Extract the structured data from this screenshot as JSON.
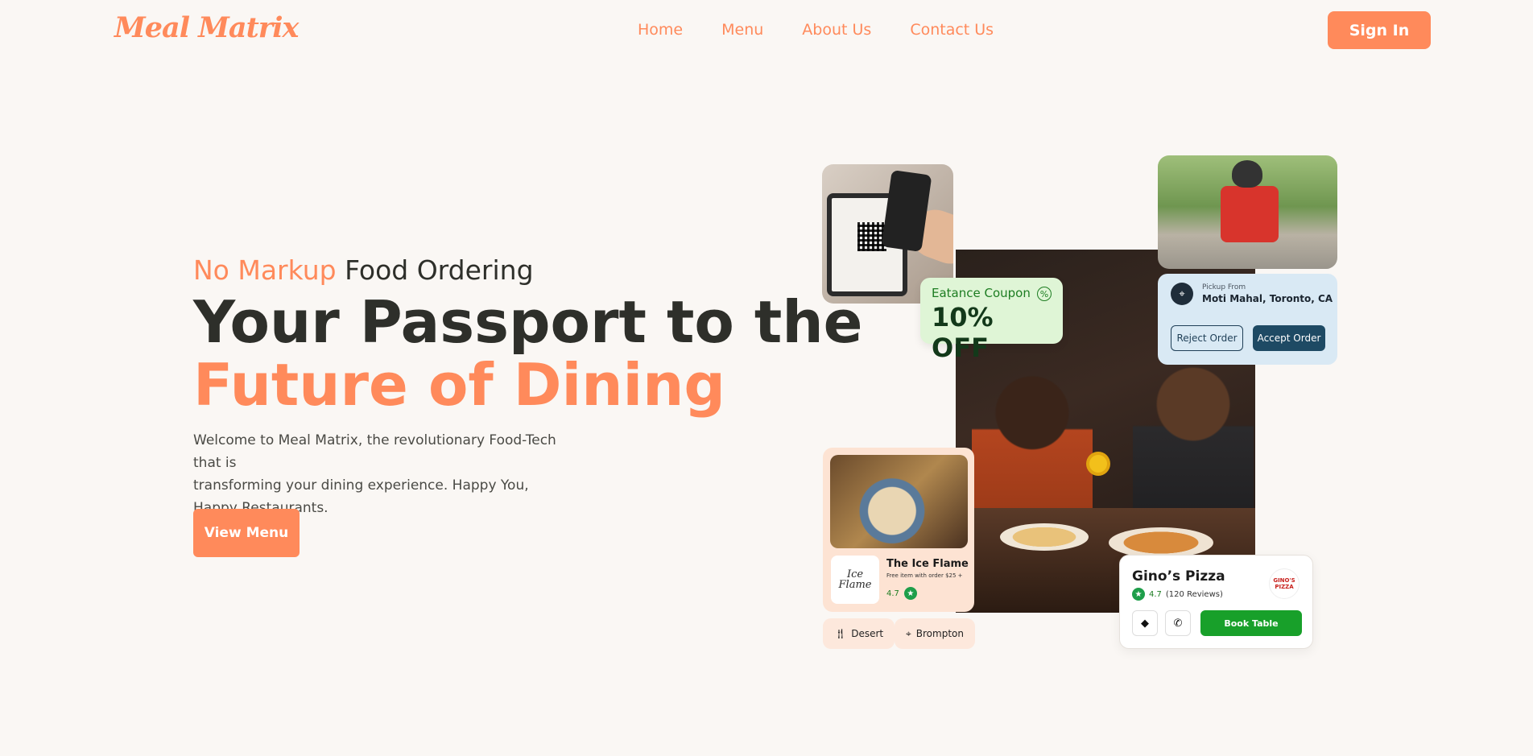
{
  "brand": {
    "logo_text": "Meal Matrix",
    "accent": "#ff8a5b"
  },
  "nav": {
    "items": [
      {
        "label": "Home"
      },
      {
        "label": "Menu"
      },
      {
        "label": "About Us"
      },
      {
        "label": "Contact Us"
      }
    ],
    "signin_label": "Sign In"
  },
  "hero": {
    "tagline_accent": "No Markup",
    "tagline_rest": " Food Ordering",
    "headline_line1": "Your Passport to the",
    "headline_line2": "Future of Dining",
    "description_line1": "Welcome to Meal Matrix, the revolutionary Food-Tech that is",
    "description_line2": "transforming your dining experience. Happy You,",
    "description_line3": "Happy Restaurants.",
    "cta_label": "View Menu"
  },
  "coupon": {
    "label": "Eatance Coupon",
    "value": "10% OFF",
    "icon": "percent-badge-icon",
    "color": "#dff5d6"
  },
  "pickup": {
    "label": "Pickup From",
    "location": "Moti Mahal, Toronto, CA",
    "reject_label": "Reject Order",
    "accept_label": "Accept Order",
    "icon": "location-pin-icon"
  },
  "restaurant_card": {
    "logo_text": "Ice Flame",
    "name": "The Ice Flame",
    "subtitle": "Free item with order $25 +",
    "rating": "4.7"
  },
  "chips": [
    {
      "icon": "fork-knife-icon",
      "label": "Desert"
    },
    {
      "icon": "location-pin-icon",
      "label": "Brompton"
    }
  ],
  "ginos": {
    "name": "Gino’s Pizza",
    "rating": "4.7",
    "reviews": "(120 Reviews)",
    "logo_text": "GINO'S PIZZA",
    "book_label": "Book Table",
    "book_color": "#18a02a"
  }
}
